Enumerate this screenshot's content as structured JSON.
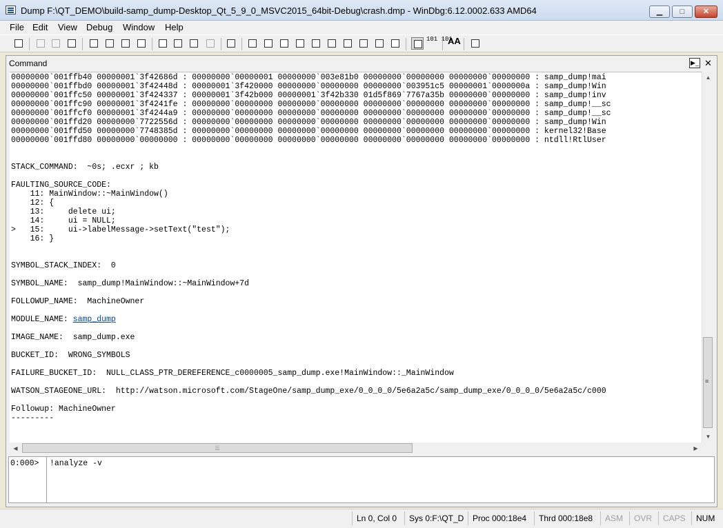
{
  "window": {
    "title": "Dump F:\\QT_DEMO\\build-samp_dump-Desktop_Qt_5_9_0_MSVC2015_64bit-Debug\\crash.dmp - WinDbg:6.12.0002.633 AMD64",
    "icon": "windbg-app-icon",
    "min_label": "▁",
    "max_label": "□",
    "close_label": "✕"
  },
  "menu": [
    "File",
    "Edit",
    "View",
    "Debug",
    "Window",
    "Help"
  ],
  "toolbar": {
    "buttons": [
      "open-icon",
      "cut-icon",
      "copy-icon",
      "paste-icon",
      "go-icon",
      "restart-icon",
      "stop-debugging-icon",
      "break-icon",
      "step-into-icon",
      "step-over-icon",
      "step-out-icon",
      "run-to-cursor-icon",
      "hand-icon",
      "command-icon",
      "watch-icon",
      "locals-icon",
      "registers-icon",
      "memory-icon",
      "call-stack-icon",
      "disassembly-icon",
      "scratch-pad-icon",
      "processes-icon",
      "source-mode-icon",
      "hex-mode-icon",
      "font-icon",
      "options-icon"
    ],
    "hex_label": "101\n101",
    "font_label": "AA"
  },
  "command_window": {
    "title": "Command",
    "close_label": "✕",
    "icon_label": "▶_",
    "lines": [
      {
        "text": "00000000`001ffb40 00000001`3f42686d : 00000000`00000001 00000000`003e81b0 00000000`00000000 00000000`00000000 : samp_dump!mai"
      },
      {
        "text": "00000000`001ffbd0 00000001`3f42448d : 00000001`3f420000 00000000`00000000 00000000`003951c5 00000001`0000000a : samp_dump!Win"
      },
      {
        "text": "00000000`001ffc50 00000001`3f424337 : 00000001`3f42b000 00000001`3f42b330 01d5f869`7767a35b 00000000`00000000 : samp_dump!inv"
      },
      {
        "text": "00000000`001ffc90 00000001`3f4241fe : 00000000`00000000 00000000`00000000 00000000`00000000 00000000`00000000 : samp_dump!__sc"
      },
      {
        "text": "00000000`001ffcf0 00000001`3f4244a9 : 00000000`00000000 00000000`00000000 00000000`00000000 00000000`00000000 : samp_dump!__sc"
      },
      {
        "text": "00000000`001ffd20 00000000`7722556d : 00000000`00000000 00000000`00000000 00000000`00000000 00000000`00000000 : samp_dump!Win"
      },
      {
        "text": "00000000`001ffd50 00000000`7748385d : 00000000`00000000 00000000`00000000 00000000`00000000 00000000`00000000 : kernel32!Base"
      },
      {
        "text": "00000000`001ffd80 00000000`00000000 : 00000000`00000000 00000000`00000000 00000000`00000000 00000000`00000000 : ntdll!RtlUser"
      },
      {
        "text": ""
      },
      {
        "text": ""
      },
      {
        "text": "STACK_COMMAND:  ~0s; .ecxr ; kb"
      },
      {
        "text": ""
      },
      {
        "text": "FAULTING_SOURCE_CODE:"
      },
      {
        "text": "    11: MainWindow::~MainWindow()"
      },
      {
        "text": "    12: {"
      },
      {
        "text": "    13:     delete ui;"
      },
      {
        "text": "    14:     ui = NULL;"
      },
      {
        "text": ">   15:     ui->labelMessage->setText(\"test\");"
      },
      {
        "text": "    16: }"
      },
      {
        "text": ""
      },
      {
        "text": ""
      },
      {
        "text": "SYMBOL_STACK_INDEX:  0"
      },
      {
        "text": ""
      },
      {
        "text": "SYMBOL_NAME:  samp_dump!MainWindow::~MainWindow+7d"
      },
      {
        "text": ""
      },
      {
        "text": "FOLLOWUP_NAME:  MachineOwner"
      },
      {
        "text": ""
      },
      {
        "text": "MODULE_NAME: ",
        "link": "samp_dump"
      },
      {
        "text": ""
      },
      {
        "text": "IMAGE_NAME:  samp_dump.exe"
      },
      {
        "text": ""
      },
      {
        "text": "BUCKET_ID:  WRONG_SYMBOLS"
      },
      {
        "text": ""
      },
      {
        "text": "FAILURE_BUCKET_ID:  NULL_CLASS_PTR_DEREFERENCE_c0000005_samp_dump.exe!MainWindow::_MainWindow"
      },
      {
        "text": ""
      },
      {
        "text": "WATSON_STAGEONE_URL:  http://watson.microsoft.com/StageOne/samp_dump_exe/0_0_0_0/5e6a2a5c/samp_dump_exe/0_0_0_0/5e6a2a5c/c000"
      },
      {
        "text": ""
      },
      {
        "text": "Followup: MachineOwner"
      },
      {
        "text": "---------"
      }
    ],
    "hscroll_grip": "⦙⦙⦙",
    "vscroll_grip": "≡",
    "prompt": "0:000>",
    "input_value": "!analyze -v"
  },
  "status": {
    "position": "Ln 0, Col 0",
    "sys": "Sys 0:F:\\QT_D",
    "proc": "Proc 000:18e4",
    "thrd": "Thrd 000:18e8",
    "asm": "ASM",
    "ovr": "OVR",
    "caps": "CAPS",
    "num": "NUM"
  }
}
